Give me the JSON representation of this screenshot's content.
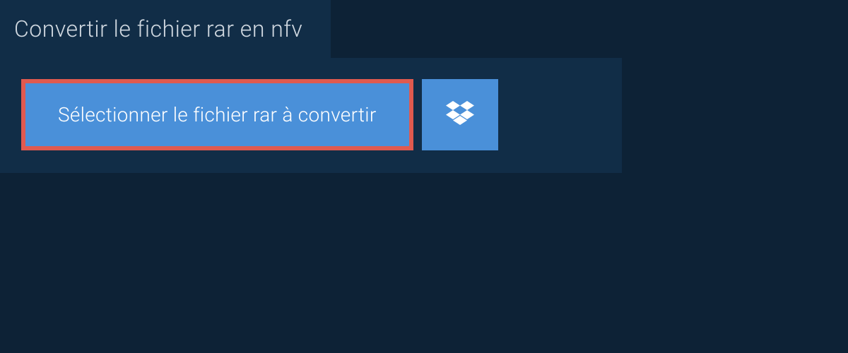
{
  "header": {
    "title": "Convertir le fichier rar en nfv"
  },
  "actions": {
    "select_file_label": "Sélectionner le fichier rar à convertir"
  },
  "colors": {
    "background": "#0d2236",
    "panel": "#112d47",
    "button": "#4a90d9",
    "highlight_border": "#e05a4f",
    "text_light": "#d0d8e0",
    "text_white": "#ffffff"
  }
}
